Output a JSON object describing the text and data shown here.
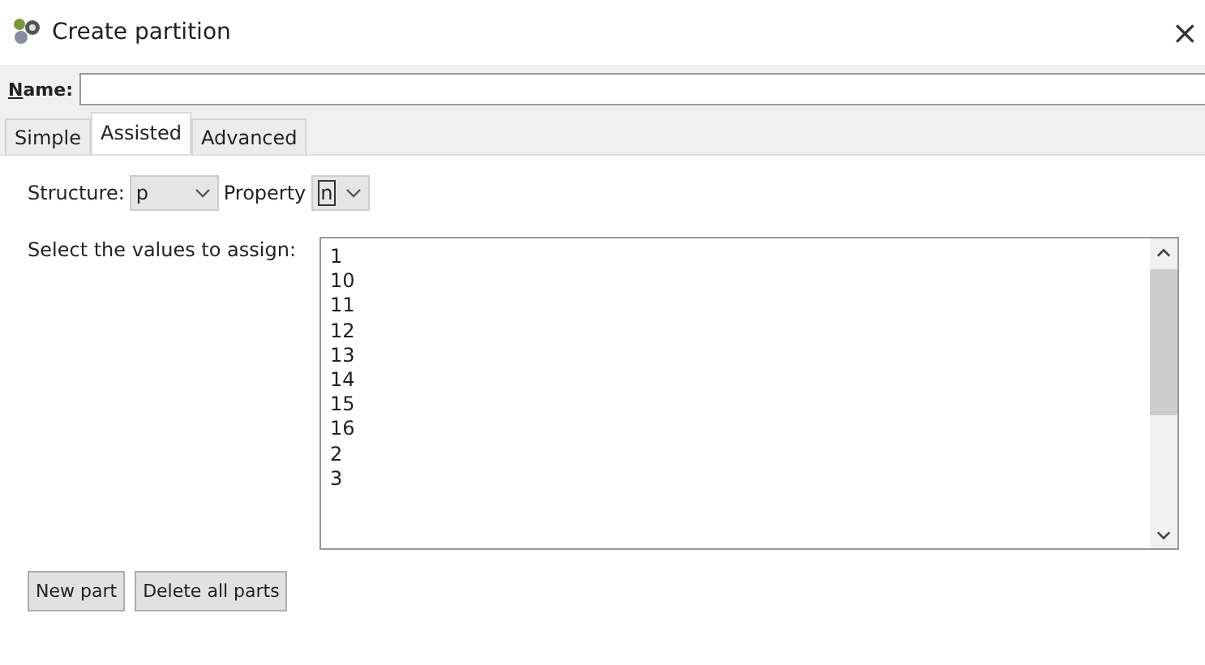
{
  "window": {
    "title": "Create partition",
    "close": "×"
  },
  "name_field": {
    "label": "Name:"
  },
  "tabs": [
    {
      "label": "Simple",
      "selected": false
    },
    {
      "label": "Assisted",
      "selected": true
    },
    {
      "label": "Advanced",
      "selected": false
    }
  ],
  "structure": {
    "label": "Structure:",
    "value": "p"
  },
  "property": {
    "label": "Property",
    "value": "n"
  },
  "values_list": {
    "label": "Select the values to assign:",
    "items": [
      "1",
      "10",
      "11",
      "12",
      "13",
      "14",
      "15",
      "16",
      "2",
      "3"
    ]
  },
  "buttons": [
    "New part",
    "Delete all parts"
  ]
}
